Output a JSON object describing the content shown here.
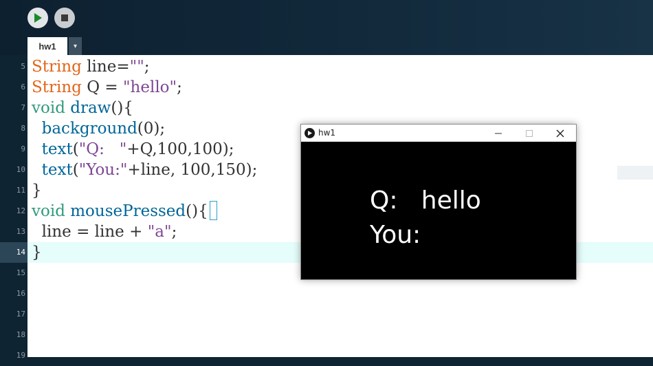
{
  "toolbar": {
    "run_label": "Run",
    "stop_label": "Stop"
  },
  "tabs": [
    {
      "label": "hw1"
    }
  ],
  "tab_menu_glyph": "▾",
  "editor": {
    "current_line": 14,
    "lines": [
      {
        "num": "5"
      },
      {
        "num": "6"
      },
      {
        "num": "7"
      },
      {
        "num": "8"
      },
      {
        "num": "9"
      },
      {
        "num": "10"
      },
      {
        "num": "11"
      },
      {
        "num": "12"
      },
      {
        "num": "13"
      },
      {
        "num": "14"
      },
      {
        "num": "15"
      },
      {
        "num": "16"
      },
      {
        "num": "17"
      },
      {
        "num": "18"
      },
      {
        "num": "19"
      }
    ],
    "code": {
      "l5": {
        "t1": "String",
        "t2": " line=",
        "t3": "\"\"",
        "t4": ";"
      },
      "l6": {
        "t1": "String",
        "t2": " Q = ",
        "t3": "\"hello\"",
        "t4": ";"
      },
      "l7": {
        "t1": "void",
        "t2": " ",
        "t3": "draw",
        "t4": "(){"
      },
      "l8": {
        "t1": "  ",
        "t2": "background",
        "t3": "(0);"
      },
      "l9": {
        "t1": "  ",
        "t2": "text",
        "t3": "(",
        "t4": "\"Q:   \"",
        "t5": "+Q,100,100);"
      },
      "l10": {
        "t1": "  ",
        "t2": "text",
        "t3": "(",
        "t4": "\"You:\"",
        "t5": "+line, 100,150);"
      },
      "l11": {
        "t1": "}"
      },
      "l12": {
        "t1": "void",
        "t2": " ",
        "t3": "mousePressed",
        "t4": "(){"
      },
      "l13": {
        "t1": "  line = line + ",
        "t2": "\"a\"",
        "t3": ";"
      },
      "l14": {
        "t1": "}"
      }
    }
  },
  "sketch_window": {
    "title": "hw1",
    "minimize_glyph": "—",
    "maximize_glyph": "☐",
    "close_glyph": "✕",
    "output_line1": "Q:   hello",
    "output_line2": "You:"
  },
  "colors": {
    "keyword": "#e2661a",
    "type_keyword": "#33997e",
    "function": "#006699",
    "string": "#7d4793",
    "current_line_bg": "#e5fdfb"
  }
}
